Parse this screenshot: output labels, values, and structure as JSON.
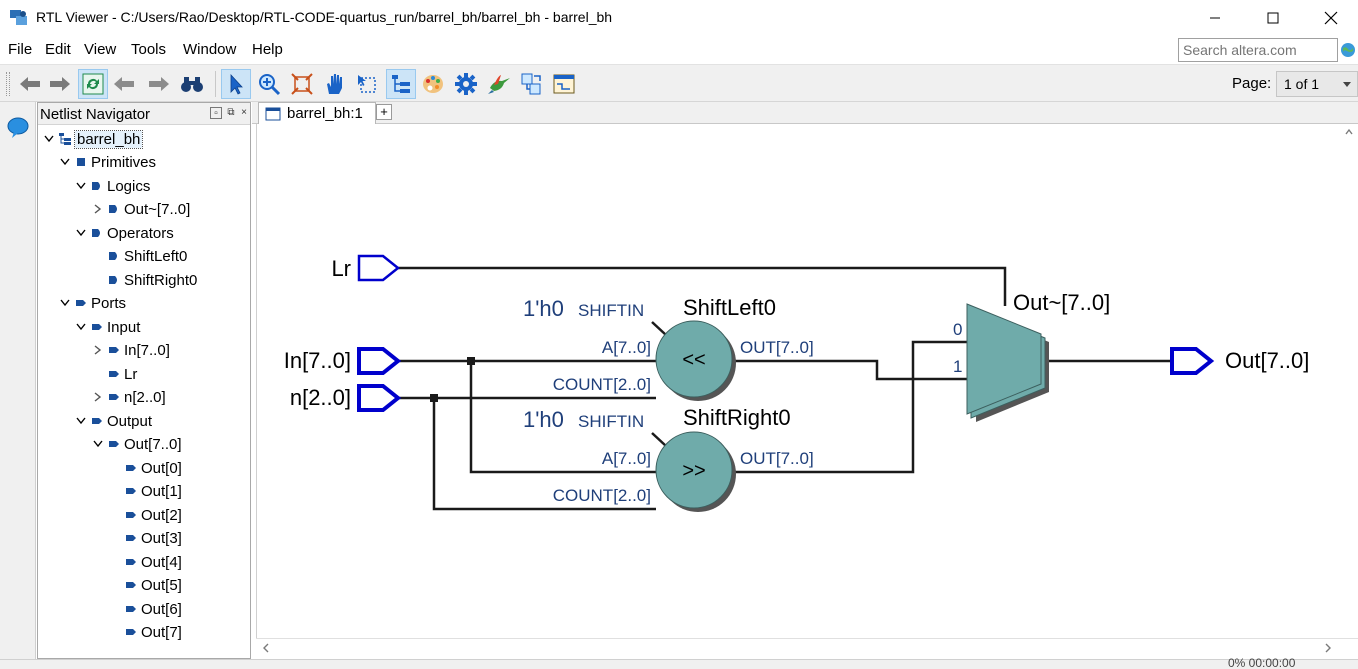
{
  "window": {
    "title": "RTL Viewer - C:/Users/Rao/Desktop/RTL-CODE-quartus_run/barrel_bh/barrel_bh - barrel_bh"
  },
  "menu": {
    "items": [
      "File",
      "Edit",
      "View",
      "Tools",
      "Window",
      "Help"
    ]
  },
  "search": {
    "placeholder": "Search altera.com"
  },
  "toolbar": {
    "page_label": "Page:",
    "page_value": "1 of 1"
  },
  "navigator": {
    "title": "Netlist Navigator",
    "items": [
      {
        "label": "barrel_bh",
        "icon": "hierarchy-icon"
      },
      {
        "label": "Primitives",
        "icon": "primitive-icon"
      },
      {
        "label": "Logics",
        "icon": "logic-icon"
      },
      {
        "label": "Out~[7..0]",
        "icon": "logic-icon"
      },
      {
        "label": "Operators",
        "icon": "operator-icon"
      },
      {
        "label": "ShiftLeft0",
        "icon": "operator-icon"
      },
      {
        "label": "ShiftRight0",
        "icon": "operator-icon"
      },
      {
        "label": "Ports",
        "icon": "port-icon"
      },
      {
        "label": "Input",
        "icon": "port-icon"
      },
      {
        "label": "In[7..0]",
        "icon": "port-icon"
      },
      {
        "label": "Lr",
        "icon": "port-icon"
      },
      {
        "label": "n[2..0]",
        "icon": "port-icon"
      },
      {
        "label": "Output",
        "icon": "port-icon"
      },
      {
        "label": "Out[7..0]",
        "icon": "port-icon"
      },
      {
        "label": "Out[0]",
        "icon": "port-icon"
      },
      {
        "label": "Out[1]",
        "icon": "port-icon"
      },
      {
        "label": "Out[2]",
        "icon": "port-icon"
      },
      {
        "label": "Out[3]",
        "icon": "port-icon"
      },
      {
        "label": "Out[4]",
        "icon": "port-icon"
      },
      {
        "label": "Out[5]",
        "icon": "port-icon"
      },
      {
        "label": "Out[6]",
        "icon": "port-icon"
      },
      {
        "label": "Out[7]",
        "icon": "port-icon"
      }
    ]
  },
  "tabs": {
    "doc_tab": "barrel_bh:1",
    "add": "+"
  },
  "schematic": {
    "inputs": {
      "lr": "Lr",
      "in": "In[7..0]",
      "n": "n[2..0]"
    },
    "output": "Out[7..0]",
    "shift_left": {
      "name": "ShiftLeft0",
      "symbol": "<<",
      "const_value": "1'h0",
      "shiftin": "SHIFTIN",
      "a_port": "A[7..0]",
      "count_port": "COUNT[2..0]",
      "out_port": "OUT[7..0]"
    },
    "shift_right": {
      "name": "ShiftRight0",
      "symbol": ">>",
      "const_value": "1'h0",
      "shiftin": "SHIFTIN",
      "a_port": "A[7..0]",
      "count_port": "COUNT[2..0]",
      "out_port": "OUT[7..0]"
    },
    "mux": {
      "name": "Out~[7..0]",
      "in0": "0",
      "in1": "1"
    }
  },
  "status": {
    "text": "0%    00:00:00"
  },
  "colors": {
    "port_blue": "#0000cc",
    "block_fill": "#6fabaa",
    "wire": "#000000",
    "accent_blue": "#0060c0"
  }
}
